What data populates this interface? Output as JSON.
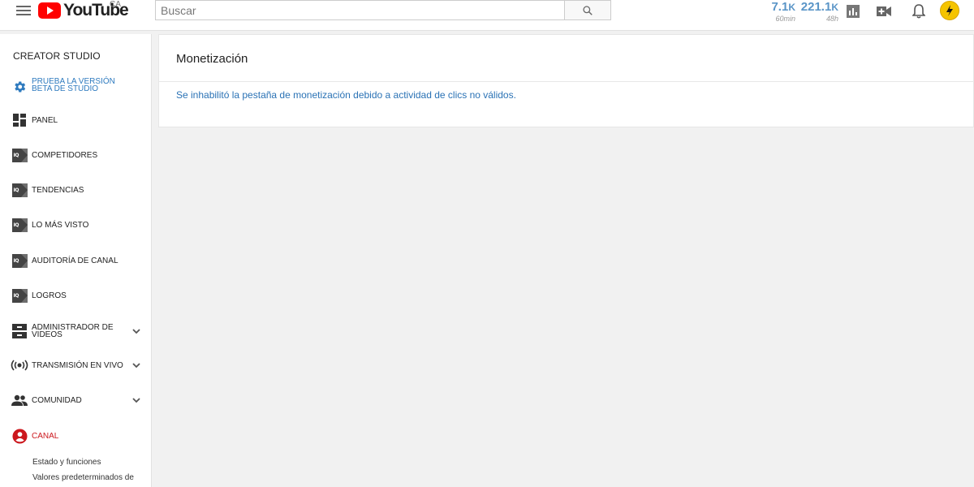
{
  "header": {
    "logo_text": "YouTube",
    "country": "CA",
    "search_placeholder": "Buscar",
    "stats": [
      {
        "value": "7.1",
        "unit": "K",
        "label": "60min"
      },
      {
        "value": "221.1",
        "unit": "K",
        "label": "48h"
      }
    ],
    "icons": [
      "analytics-icon",
      "create-video-icon",
      "bell-icon"
    ]
  },
  "sidebar": {
    "title": "CREATOR STUDIO",
    "items": [
      {
        "label": "PRUEBA LA VERSIÓN BETA DE STUDIO",
        "icon": "gear-icon"
      },
      {
        "label": "PANEL",
        "icon": "dashboard-icon"
      },
      {
        "label": "COMPETIDORES",
        "icon": "iq-icon"
      },
      {
        "label": "TENDENCIAS",
        "icon": "iq-icon"
      },
      {
        "label": "LO MÁS VISTO",
        "icon": "iq-icon"
      },
      {
        "label": "AUDITORÍA DE CANAL",
        "icon": "iq-icon"
      },
      {
        "label": "LOGROS",
        "icon": "iq-icon"
      },
      {
        "label": "ADMINISTRADOR DE VIDEOS",
        "icon": "video-manager-icon"
      },
      {
        "label": "TRANSMISIÓN EN VIVO",
        "icon": "live-icon"
      },
      {
        "label": "COMUNIDAD",
        "icon": "community-icon"
      },
      {
        "label": "CANAL",
        "icon": "account-icon"
      }
    ],
    "iq_text": "IQ",
    "sub_items": [
      "Estado y funciones",
      "Valores predeterminados de"
    ]
  },
  "main": {
    "title": "Monetización",
    "message": "Se inhabilitó la pestaña de monetización debido a actividad de clics no válidos."
  },
  "colors": {
    "accent_blue": "#2a72b5",
    "active_red": "#cc181e",
    "stat_blue": "#5a95c7"
  }
}
